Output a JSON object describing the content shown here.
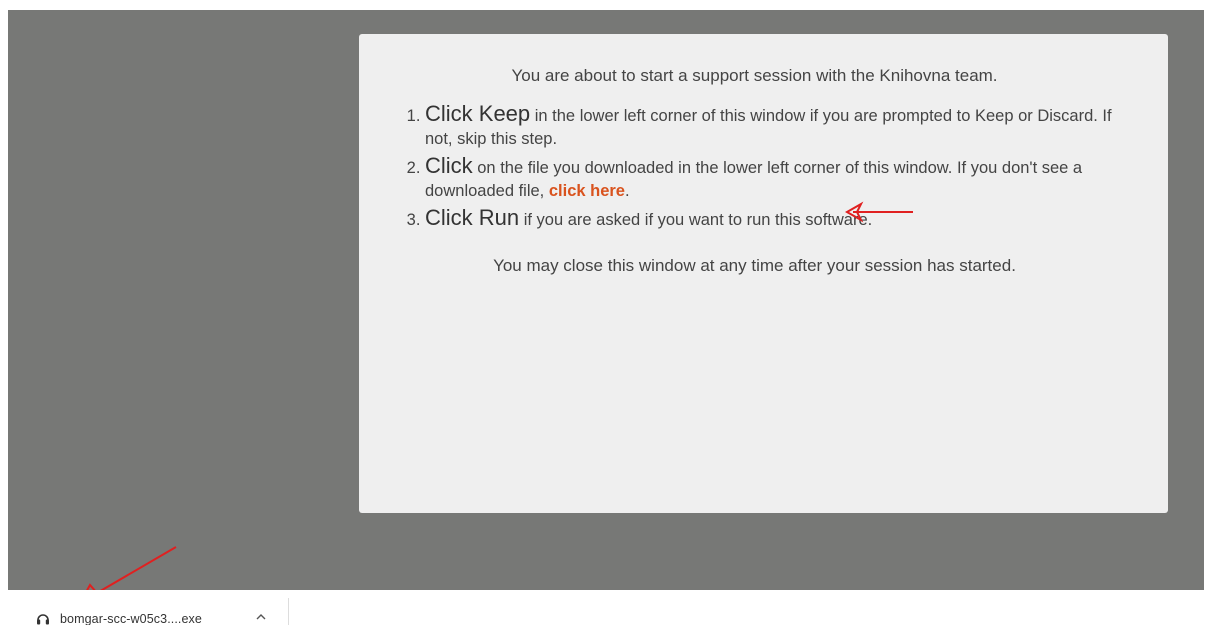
{
  "card": {
    "intro": "You are about to start a support session with the Knihovna team.",
    "steps": [
      {
        "emph": "Click Keep",
        "text": " in the lower left corner of this window if you are prompted to Keep or Discard. If not, skip this step."
      },
      {
        "emph": "Click",
        "text": " on the file you downloaded in the lower left corner of this window. If you don't see a downloaded file, ",
        "link": "click here",
        "after": "."
      },
      {
        "emph": "Click Run",
        "text": " if you are asked if you want to run this software."
      }
    ],
    "outro": "You may close this window at any time after your session has started."
  },
  "download_bar": {
    "file_name": "bomgar-scc-w05c3....exe",
    "file_icon": "headset-icon",
    "expand_icon": "chevron-up-icon"
  },
  "annotations": {
    "arrow_color": "#e02020"
  },
  "colors": {
    "viewport_bg": "#777876",
    "card_bg": "#efefef",
    "link": "#d9531e"
  }
}
